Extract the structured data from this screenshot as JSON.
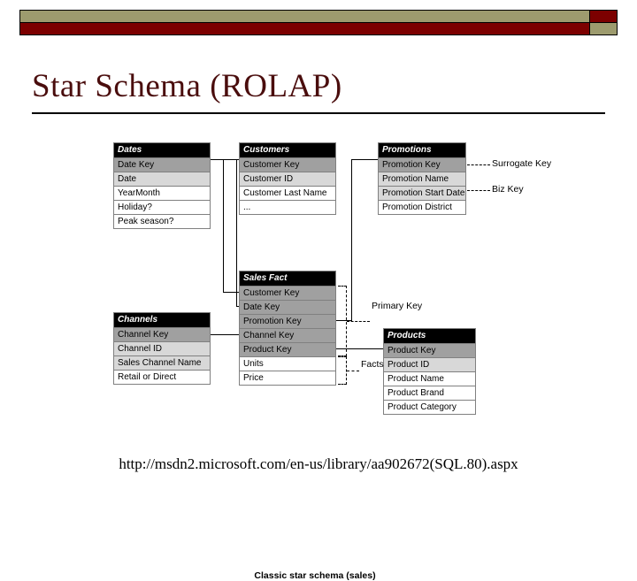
{
  "slide": {
    "title": "Star Schema (ROLAP)",
    "source_url": "http://msdn2.microsoft.com/en-us/library/aa902672(SQL.80).aspx"
  },
  "header_bar": {
    "olive_color": "#9d9b6e",
    "maroon_color": "#7c0000"
  },
  "diagram": {
    "caption": "Classic star schema (sales)",
    "annotations": {
      "surrogate_key": "Surrogate Key",
      "biz_key": "Biz Key",
      "primary_key": "Primary Key",
      "facts": "Facts"
    },
    "entities": [
      {
        "id": "dates",
        "name": "Dates",
        "rows": [
          {
            "label": "Date Key",
            "kind": "surrogate"
          },
          {
            "label": "Date",
            "kind": "biz"
          },
          {
            "label": "YearMonth",
            "kind": "plain"
          },
          {
            "label": "Holiday?",
            "kind": "plain"
          },
          {
            "label": "Peak season?",
            "kind": "plain"
          }
        ]
      },
      {
        "id": "customers",
        "name": "Customers",
        "rows": [
          {
            "label": "Customer Key",
            "kind": "surrogate"
          },
          {
            "label": "Customer ID",
            "kind": "biz"
          },
          {
            "label": "Customer Last Name",
            "kind": "plain"
          },
          {
            "label": "...",
            "kind": "plain"
          }
        ]
      },
      {
        "id": "promotions",
        "name": "Promotions",
        "rows": [
          {
            "label": "Promotion Key",
            "kind": "surrogate"
          },
          {
            "label": "Promotion Name",
            "kind": "biz"
          },
          {
            "label": "Promotion Start Date",
            "kind": "biz"
          },
          {
            "label": "Promotion District",
            "kind": "plain"
          }
        ]
      },
      {
        "id": "channels",
        "name": "Channels",
        "rows": [
          {
            "label": "Channel Key",
            "kind": "surrogate"
          },
          {
            "label": "Channel ID",
            "kind": "biz"
          },
          {
            "label": "Sales Channel Name",
            "kind": "biz"
          },
          {
            "label": "Retail or Direct",
            "kind": "plain"
          }
        ]
      },
      {
        "id": "sales-fact",
        "name": "Sales Fact",
        "rows": [
          {
            "label": "Customer Key",
            "kind": "surrogate"
          },
          {
            "label": "Date Key",
            "kind": "surrogate"
          },
          {
            "label": "Promotion Key",
            "kind": "surrogate"
          },
          {
            "label": "Channel Key",
            "kind": "surrogate"
          },
          {
            "label": "Product Key",
            "kind": "surrogate"
          },
          {
            "label": "Units",
            "kind": "plain"
          },
          {
            "label": "Price",
            "kind": "plain"
          }
        ]
      },
      {
        "id": "products",
        "name": "Products",
        "rows": [
          {
            "label": "Product Key",
            "kind": "surrogate"
          },
          {
            "label": "Product ID",
            "kind": "biz"
          },
          {
            "label": "Product Name",
            "kind": "plain"
          },
          {
            "label": "Product Brand",
            "kind": "plain"
          },
          {
            "label": "Product Category",
            "kind": "plain"
          }
        ]
      }
    ]
  }
}
